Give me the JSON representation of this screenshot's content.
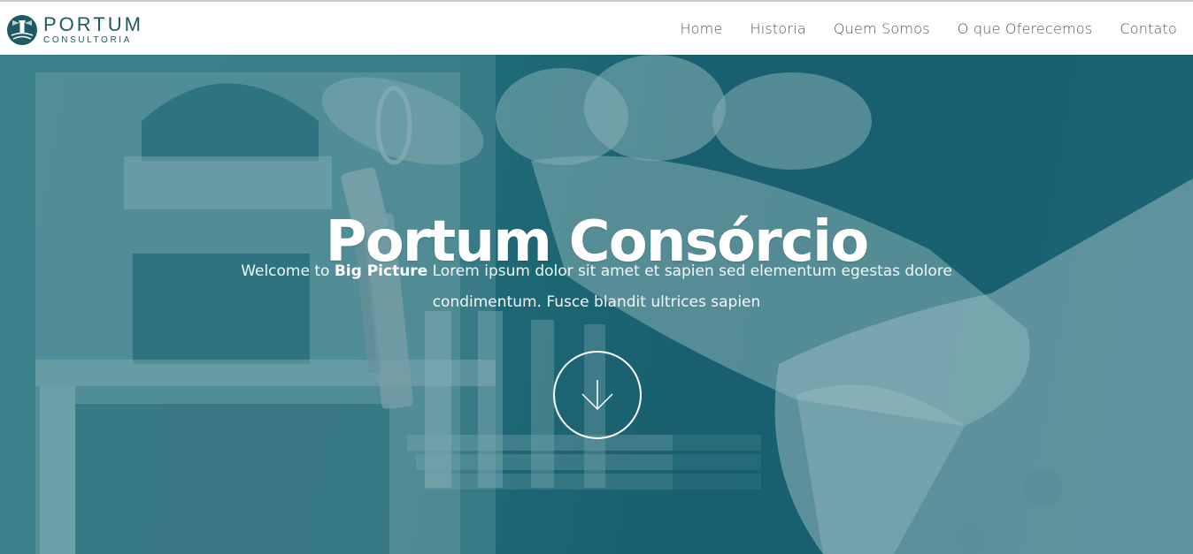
{
  "brand": {
    "name": "PORTUM",
    "subtitle": "CONSULTORIA",
    "logo_icon": "lighthouse-emblem-icon",
    "color": "#1f5a63"
  },
  "nav": {
    "items": [
      {
        "label": "Home"
      },
      {
        "label": "Historia"
      },
      {
        "label": "Quem Somos"
      },
      {
        "label": "O que Oferecemos"
      },
      {
        "label": "Contato"
      }
    ]
  },
  "hero": {
    "title": "Portum Consórcio",
    "intro_prefix": "Welcome to ",
    "intro_bold": "Big Picture",
    "intro_suffix": " Lorem ipsum dolor sit amet et sapien sed elementum egestas dolore condimentum. Fusce blandit ultrices sapien",
    "overlay_color": "#1a6f7d",
    "scroll_icon": "arrow-down-icon"
  }
}
